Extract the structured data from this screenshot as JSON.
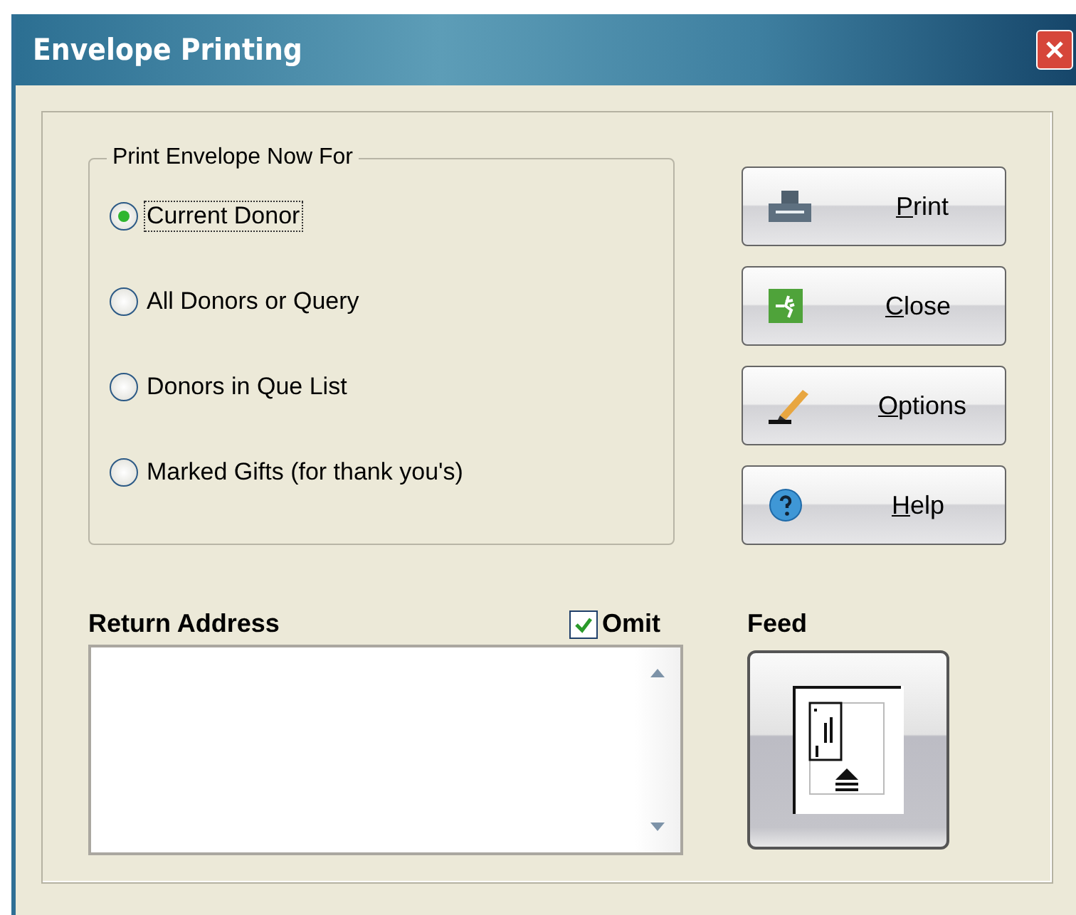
{
  "window": {
    "title": "Envelope Printing"
  },
  "print_for": {
    "label": "Print Envelope Now For",
    "options": [
      {
        "label": "Current Donor",
        "selected": true
      },
      {
        "label": "All Donors or Query",
        "selected": false
      },
      {
        "label": "Donors in Que List",
        "selected": false
      },
      {
        "label": "Marked Gifts (for thank you's)",
        "selected": false
      }
    ]
  },
  "buttons": [
    {
      "kind": "print",
      "label": "Print"
    },
    {
      "kind": "close",
      "label": "Close"
    },
    {
      "kind": "options",
      "label": "Options"
    },
    {
      "kind": "help",
      "label": "Help"
    }
  ],
  "return_address": {
    "label": "Return Address",
    "omit": {
      "label": "Omit",
      "checked": true
    }
  },
  "feed": {
    "label": "Feed"
  }
}
